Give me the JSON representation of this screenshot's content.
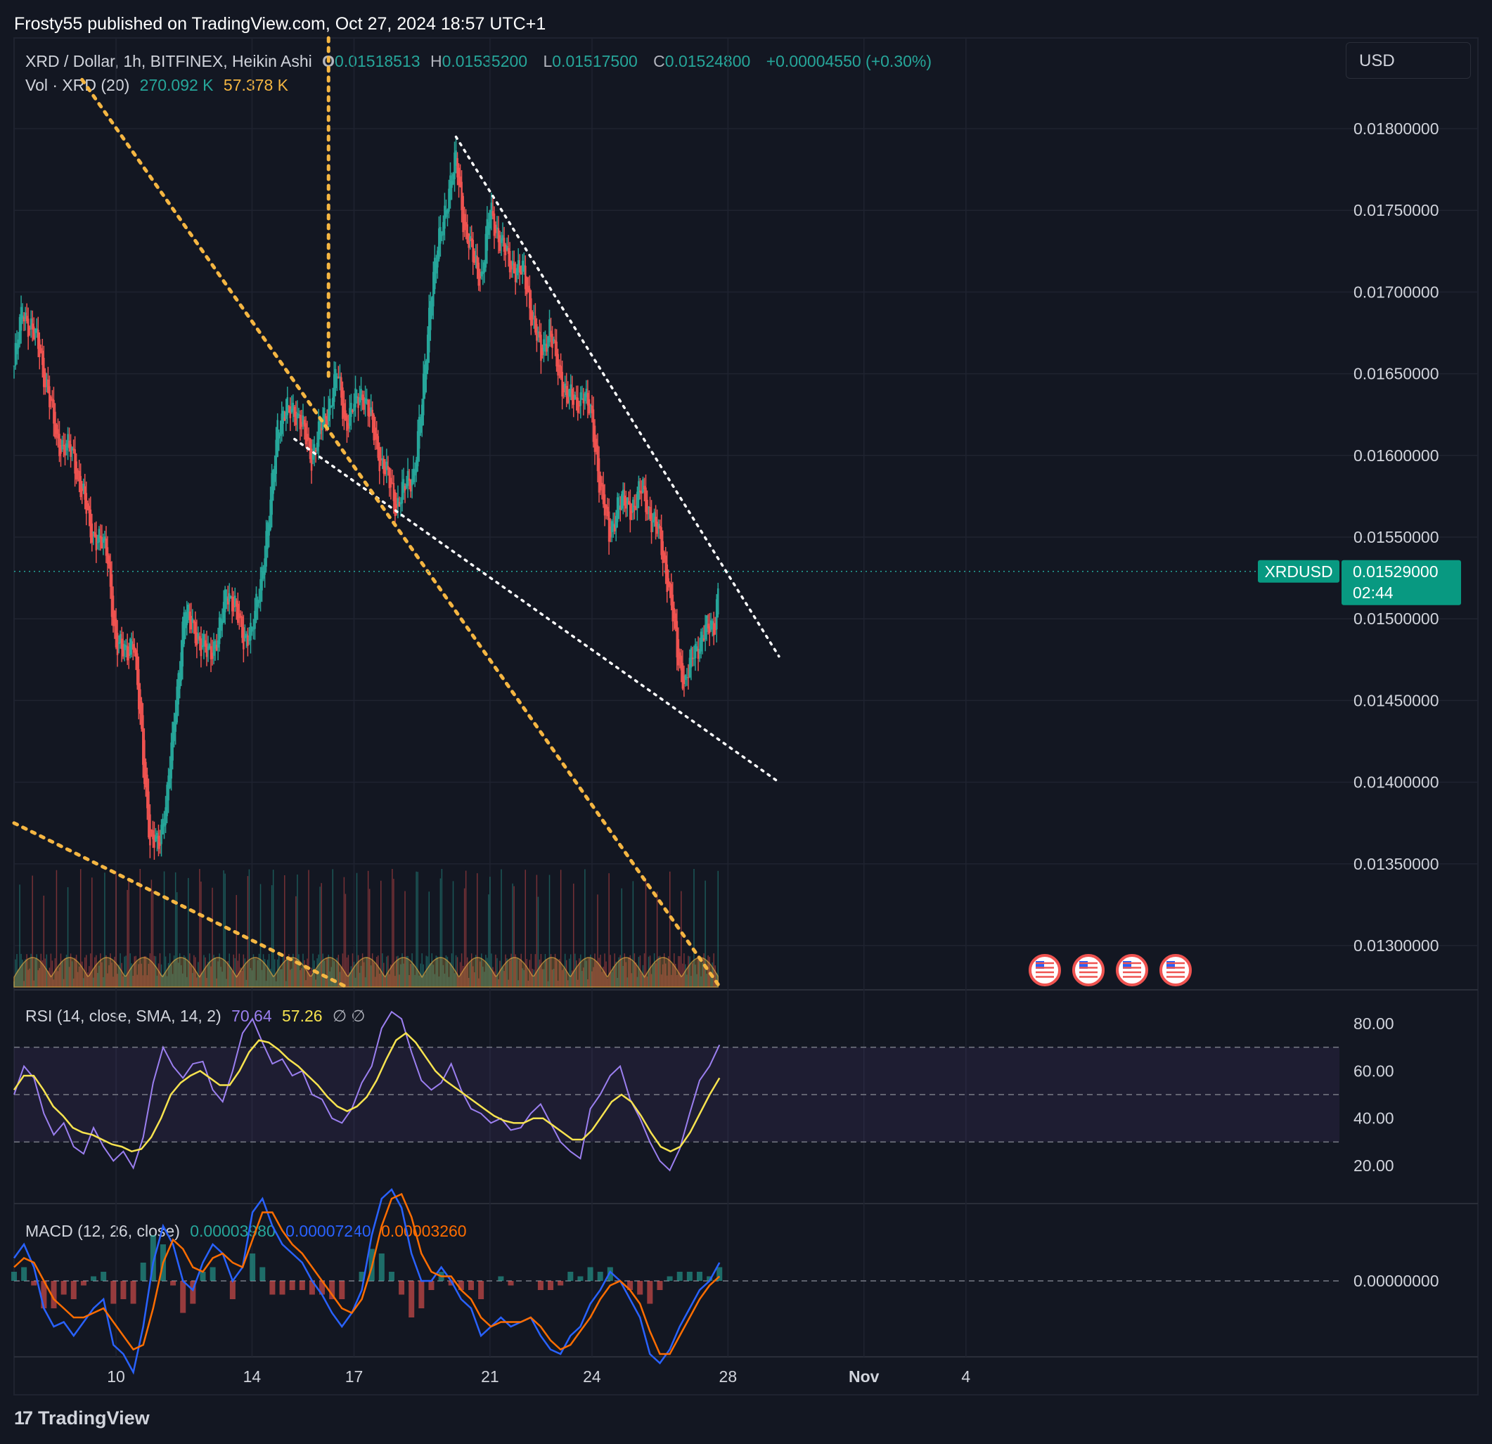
{
  "publisher": "Frosty55 published on TradingView.com, Oct 27, 2024 18:57 UTC+1",
  "footer_brand": "TradingView",
  "currency_button": "USD",
  "legend": {
    "symbol": "XRD / Dollar, 1h, BITFINEX, Heikin Ashi",
    "o_label": "O",
    "o_value": "0.01518513",
    "h_label": "H",
    "h_value": "0.01535200",
    "l_label": "L",
    "l_value": "0.01517500",
    "c_label": "C",
    "c_value": "0.01524800",
    "change": "+0.00004550 (+0.30%)",
    "vol_label": "Vol · XRD (20)",
    "vol_value1": "270.092 K",
    "vol_value2": "57.378 K"
  },
  "rsi_legend": {
    "label": "RSI (14, close, SMA, 14, 2)",
    "value1": "70.64",
    "value2": "57.26",
    "extra": "∅ ∅"
  },
  "macd_legend": {
    "label": "MACD (12, 26, close)",
    "value1": "0.00003980",
    "value2": "0.00007240",
    "value3": "0.00003260"
  },
  "price_tag": {
    "symbol": "XRDUSD",
    "price": "0.01529000",
    "countdown": "02:44"
  },
  "colors": {
    "up": "#26a69a",
    "down": "#ef5350",
    "background": "#131722",
    "grid": "#1f2330",
    "rsi": "#9b7ff0",
    "rsi_ma": "#f7e34f",
    "macd": "#2962ff",
    "signal": "#ff6d00",
    "trendline_yellow": "#f5b642"
  },
  "chart_data": [
    {
      "type": "candlestick",
      "style": "Heikin Ashi",
      "title": "XRD / Dollar, 1h, BITFINEX, Heikin Ashi",
      "x_ticks": [
        "10",
        "14",
        "17",
        "21",
        "24",
        "28",
        "Nov",
        "4"
      ],
      "y_ticks": [
        "0.01300000",
        "0.01350000",
        "0.01400000",
        "0.01450000",
        "0.01500000",
        "0.01550000",
        "0.01600000",
        "0.01650000",
        "0.01700000",
        "0.01750000",
        "0.01800000"
      ],
      "ylim": [
        0.01275,
        0.01835
      ],
      "last_price": 0.01529,
      "price_path": [
        [
          "Oct 7 00:00",
          0.01655
        ],
        [
          "Oct 7 06:00",
          0.0169
        ],
        [
          "Oct 7 18:00",
          0.01665
        ],
        [
          "Oct 8 06:00",
          0.0161
        ],
        [
          "Oct 8 18:00",
          0.016
        ],
        [
          "Oct 9 06:00",
          0.01555
        ],
        [
          "Oct 9 18:00",
          0.0154
        ],
        [
          "Oct 10 00:00",
          0.0148
        ],
        [
          "Oct 10 12:00",
          0.01485
        ],
        [
          "Oct 10 18:00",
          0.0143
        ],
        [
          "Oct 11 00:00",
          0.0136
        ],
        [
          "Oct 11 06:00",
          0.01365
        ],
        [
          "Oct 11 12:00",
          0.0139
        ],
        [
          "Oct 11 18:00",
          0.0145
        ],
        [
          "Oct 12 00:00",
          0.015
        ],
        [
          "Oct 12 06:00",
          0.015
        ],
        [
          "Oct 12 12:00",
          0.0148
        ],
        [
          "Oct 13 00:00",
          0.01485
        ],
        [
          "Oct 13 06:00",
          0.0152
        ],
        [
          "Oct 13 18:00",
          0.0149
        ],
        [
          "Oct 14 00:00",
          0.0149
        ],
        [
          "Oct 14 12:00",
          0.0156
        ],
        [
          "Oct 14 18:00",
          0.0162
        ],
        [
          "Oct 15 06:00",
          0.0163
        ],
        [
          "Oct 15 18:00",
          0.016
        ],
        [
          "Oct 16 06:00",
          0.0163
        ],
        [
          "Oct 16 12:00",
          0.0165
        ],
        [
          "Oct 16 18:00",
          0.0162
        ],
        [
          "Oct 17 06:00",
          0.0164
        ],
        [
          "Oct 17 18:00",
          0.016
        ],
        [
          "Oct 18 06:00",
          0.0157
        ],
        [
          "Oct 18 18:00",
          0.0159
        ],
        [
          "Oct 19 00:00",
          0.0163
        ],
        [
          "Oct 19 06:00",
          0.017
        ],
        [
          "Oct 19 12:00",
          0.0173
        ],
        [
          "Oct 19 18:00",
          0.0176
        ],
        [
          "Oct 20 00:00",
          0.0178
        ],
        [
          "Oct 20 06:00",
          0.0174
        ],
        [
          "Oct 20 12:00",
          0.0172
        ],
        [
          "Oct 20 18:00",
          0.0171
        ],
        [
          "Oct 21 00:00",
          0.0175
        ],
        [
          "Oct 21 12:00",
          0.0172
        ],
        [
          "Oct 22 00:00",
          0.0171
        ],
        [
          "Oct 22 12:00",
          0.0166
        ],
        [
          "Oct 22 18:00",
          0.0168
        ],
        [
          "Oct 23 00:00",
          0.0165
        ],
        [
          "Oct 23 12:00",
          0.0163
        ],
        [
          "Oct 23 18:00",
          0.0164
        ],
        [
          "Oct 24 00:00",
          0.0162
        ],
        [
          "Oct 24 06:00",
          0.0158
        ],
        [
          "Oct 24 12:00",
          0.0155
        ],
        [
          "Oct 24 18:00",
          0.0157
        ],
        [
          "Oct 25 06:00",
          0.0157
        ],
        [
          "Oct 25 12:00",
          0.0158
        ],
        [
          "Oct 25 18:00",
          0.0156
        ],
        [
          "Oct 26 00:00",
          0.0155
        ],
        [
          "Oct 26 06:00",
          0.0152
        ],
        [
          "Oct 26 12:00",
          0.0148
        ],
        [
          "Oct 26 18:00",
          0.0146
        ],
        [
          "Oct 27 00:00",
          0.0148
        ],
        [
          "Oct 27 06:00",
          0.0149
        ],
        [
          "Oct 27 12:00",
          0.01495
        ],
        [
          "Oct 27 15:00",
          0.015
        ],
        [
          "Oct 27 18:00",
          0.01529
        ]
      ],
      "trendlines": [
        {
          "color": "white",
          "style": "dotted",
          "from": [
            "Oct 20 00:00",
            0.01795
          ],
          "to": [
            "Oct 29 12:00",
            0.01477
          ]
        },
        {
          "color": "white",
          "style": "dotted",
          "from": [
            "Oct 15 06:00",
            0.0161
          ],
          "to": [
            "Oct 29 12:00",
            0.014
          ]
        },
        {
          "color": "yellow",
          "style": "dotted",
          "from": [
            "Oct 9 00:00",
            0.0183
          ],
          "to": [
            "Oct 27 18:00",
            0.01275
          ]
        },
        {
          "color": "yellow",
          "style": "dotted",
          "from": [
            "Oct 7 00:00",
            0.01375
          ],
          "to": [
            "Oct 16 18:00",
            0.01275
          ]
        },
        {
          "color": "yellow",
          "style": "dotted",
          "vertical_at": "Oct 16 06:00"
        }
      ],
      "event_markers": 4
    },
    {
      "type": "line",
      "title": "RSI (14, close, SMA, 14, 2)",
      "y_ticks": [
        "20.00",
        "40.00",
        "60.00",
        "80.00"
      ],
      "ylim": [
        10,
        88
      ],
      "bands": [
        30,
        50,
        70
      ],
      "series": [
        {
          "name": "RSI",
          "values": [
            50,
            62,
            57,
            42,
            33,
            38,
            28,
            25,
            36,
            28,
            22,
            26,
            19,
            32,
            55,
            70,
            62,
            57,
            63,
            64,
            52,
            47,
            60,
            76,
            82,
            72,
            63,
            65,
            58,
            60,
            50,
            48,
            40,
            38,
            44,
            55,
            62,
            78,
            85,
            82,
            68,
            56,
            52,
            55,
            63,
            52,
            44,
            42,
            38,
            40,
            35,
            36,
            42,
            46,
            38,
            30,
            26,
            23,
            44,
            50,
            58,
            62,
            48,
            40,
            30,
            22,
            18,
            27,
            42,
            56,
            62,
            71
          ]
        },
        {
          "name": "RSI-based MA",
          "values": [
            52,
            58,
            58,
            52,
            45,
            41,
            36,
            34,
            33,
            31,
            29,
            28,
            26,
            27,
            32,
            40,
            50,
            55,
            58,
            60,
            57,
            54,
            54,
            60,
            68,
            73,
            72,
            69,
            65,
            62,
            58,
            54,
            49,
            45,
            43,
            45,
            49,
            56,
            65,
            73,
            76,
            72,
            66,
            60,
            56,
            53,
            50,
            47,
            44,
            41,
            39,
            38,
            38,
            40,
            40,
            37,
            34,
            31,
            31,
            35,
            41,
            47,
            50,
            47,
            41,
            34,
            28,
            26,
            28,
            34,
            42,
            50,
            57
          ]
        }
      ]
    },
    {
      "type": "line",
      "title": "MACD (12, 26, close)",
      "y_ticks": [
        "0.00000000"
      ],
      "ylim": [
        -0.00027,
        0.00026
      ],
      "series": [
        {
          "name": "MACD",
          "values": [
            5e-05,
            8e-05,
            3e-05,
            -6e-05,
            -0.0001,
            -9e-05,
            -0.00012,
            -9e-05,
            -6e-05,
            -4e-05,
            -0.00014,
            -0.00016,
            -0.0002,
            -0.0001,
            4e-05,
            0.00012,
            8e-05,
            0.0,
            -2e-05,
            4e-05,
            8e-05,
            6e-05,
            0.0,
            3e-05,
            0.00015,
            0.00018,
            0.00012,
            8e-05,
            6e-05,
            4e-05,
            0.0,
            -3e-05,
            -7e-05,
            -0.0001,
            -7e-05,
            -2e-05,
            0.0001,
            0.00018,
            0.0002,
            0.00016,
            6e-05,
            0.0,
            0.0,
            3e-05,
            0.0,
            -4e-05,
            -6e-05,
            -0.00012,
            -0.0001,
            -8e-05,
            -0.0001,
            -9e-05,
            -8e-05,
            -0.00012,
            -0.00015,
            -0.00016,
            -0.00012,
            -0.0001,
            -5e-05,
            -2e-05,
            2e-05,
            0.0,
            -4e-05,
            -8e-05,
            -0.00016,
            -0.00018,
            -0.00015,
            -0.0001,
            -6e-05,
            -2e-05,
            0.0,
            4e-05
          ]
        },
        {
          "name": "Signal",
          "values": [
            3e-05,
            5e-05,
            4e-05,
            0.0,
            -4e-05,
            -6e-05,
            -8e-05,
            -8e-05,
            -7e-05,
            -6e-05,
            -9e-05,
            -0.00012,
            -0.00015,
            -0.00014,
            -6e-05,
            4e-05,
            9e-05,
            7e-05,
            3e-05,
            2e-05,
            5e-05,
            6e-05,
            4e-05,
            3e-05,
            9e-05,
            0.00015,
            0.00015,
            0.00011,
            8e-05,
            6e-05,
            3e-05,
            0.0,
            -3e-05,
            -6e-05,
            -7e-05,
            -4e-05,
            3e-05,
            0.00012,
            0.00018,
            0.00019,
            0.00014,
            6e-05,
            2e-05,
            1e-05,
            1e-05,
            -2e-05,
            -4e-05,
            -8e-05,
            -0.0001,
            -9e-05,
            -9e-05,
            -9e-05,
            -8e-05,
            -0.0001,
            -0.00013,
            -0.00015,
            -0.00014,
            -0.00011,
            -8e-05,
            -4e-05,
            -1e-05,
            0.0,
            -2e-05,
            -5e-05,
            -0.00011,
            -0.00016,
            -0.00016,
            -0.00012,
            -8e-05,
            -4e-05,
            -1e-05,
            1e-05
          ]
        }
      ]
    }
  ]
}
